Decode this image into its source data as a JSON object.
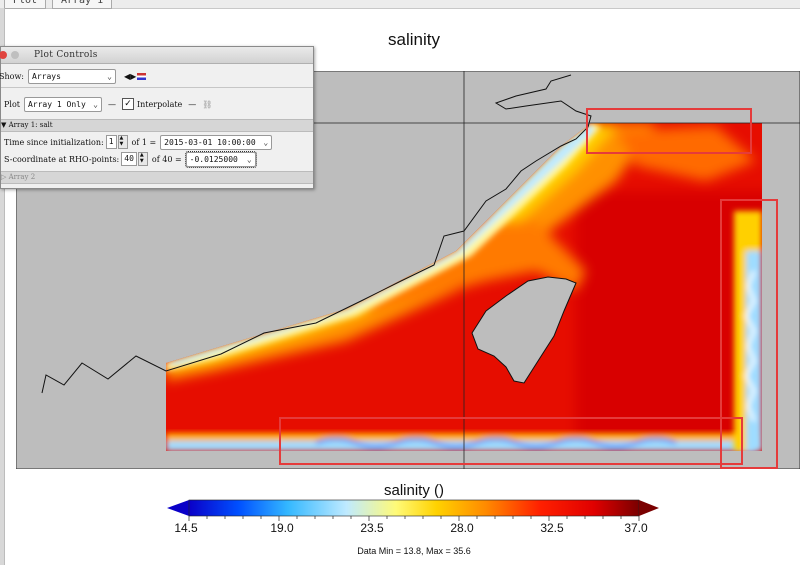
{
  "tabs": [
    "Plot",
    "Array 1"
  ],
  "plot": {
    "title": "salinity"
  },
  "colorbar": {
    "title": "salinity ()",
    "ticks": [
      "14.5",
      "19.0",
      "23.5",
      "28.0",
      "32.5",
      "37.0"
    ],
    "stats": "Data Min = 13.8, Max = 35.6",
    "colors": [
      "#0a00c8",
      "#0050ff",
      "#34b8ff",
      "#bfeaff",
      "#fffa78",
      "#ffd200",
      "#ff8a00",
      "#ff2000",
      "#e00000",
      "#7a0000"
    ]
  },
  "controls": {
    "window_title": "Plot Controls",
    "show_label": "Show:",
    "show_value": "Arrays",
    "plot_label": "Plot",
    "plot_value": "Array 1 Only",
    "interpolate_label": "Interpolate",
    "interpolate_checked": true,
    "section1": "Array 1: salt",
    "time_label": "Time since initialization:",
    "time_index": "1",
    "time_of": "of 1 =",
    "time_value": "2015-03-01 10:00:00",
    "s_label": "S-coordinate at RHO-points:",
    "s_index": "40",
    "s_of": "of 40 =",
    "s_value": "-0.0125000",
    "section2": "Array 2"
  }
}
